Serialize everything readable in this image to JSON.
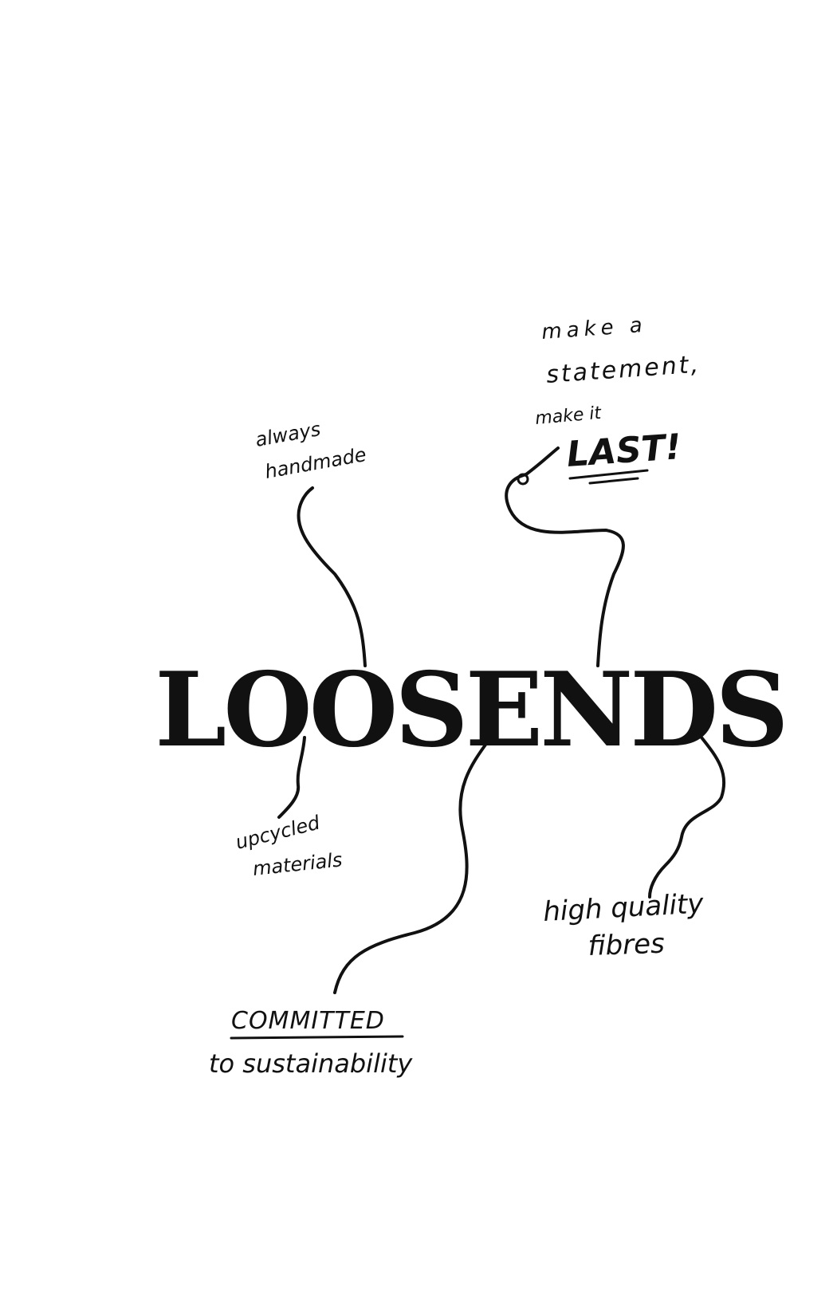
{
  "brand": {
    "wordmark": "LOOSENDS"
  },
  "notes": {
    "handmade": {
      "line1": "always",
      "line2": "handmade"
    },
    "statement": {
      "line1": "make a",
      "line2": "statement,",
      "line3": "make it",
      "emphasis": "LAST!"
    },
    "upcycled": {
      "line1": "upcycled",
      "line2": "materials"
    },
    "quality": {
      "line1": "high quality",
      "line2": "fibres"
    },
    "committed": {
      "line1": "COMMITTED",
      "line2": "to sustainability"
    }
  },
  "colors": {
    "ink": "#111111",
    "background": "#ffffff"
  }
}
